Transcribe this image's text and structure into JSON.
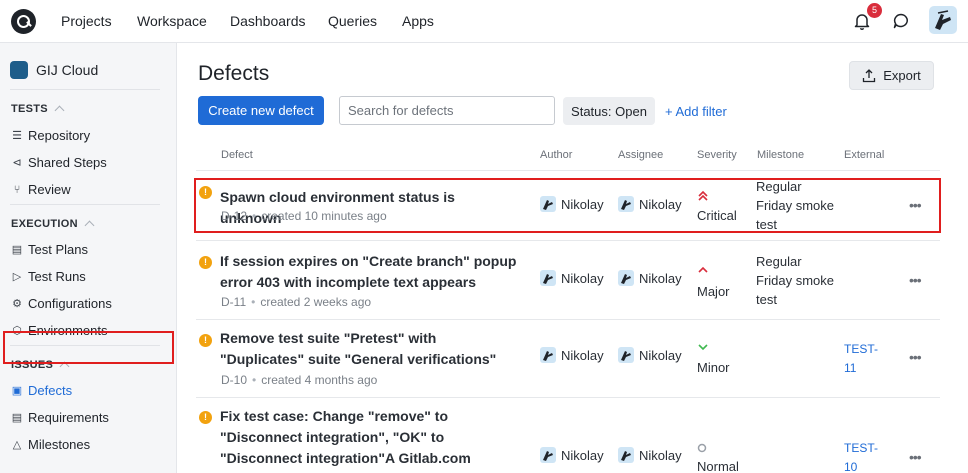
{
  "topnav": {
    "items": [
      "Projects",
      "Workspace",
      "Dashboards",
      "Queries",
      "Apps"
    ],
    "notification_count": "5"
  },
  "sidebar": {
    "project_name": "GIJ Cloud",
    "sections": [
      {
        "title": "TESTS",
        "items": [
          "Repository",
          "Shared Steps",
          "Review"
        ]
      },
      {
        "title": "EXECUTION",
        "items": [
          "Test Plans",
          "Test Runs",
          "Configurations",
          "Environments"
        ]
      },
      {
        "title": "ISSUES",
        "items": [
          "Defects",
          "Requirements",
          "Milestones"
        ]
      }
    ]
  },
  "page": {
    "title": "Defects",
    "export_label": "Export",
    "create_label": "Create new defect",
    "search_placeholder": "Search for defects",
    "status_filter": "Status: Open",
    "add_filter": "+ Add filter"
  },
  "table": {
    "headers": [
      "Defect",
      "Author",
      "Assignee",
      "Severity",
      "Milestone",
      "External"
    ],
    "rows": [
      {
        "title": "Spawn cloud environment status is unknown",
        "id": "D-12",
        "created": "created 10 minutes ago",
        "author": "Nikolay",
        "assignee": "Nikolay",
        "severity": "Critical",
        "milestone": "Regular Friday smoke test",
        "external": ""
      },
      {
        "title": "If session expires on \"Create branch\" popup error 403 with incomplete text appears",
        "id": "D-11",
        "created": "created 2 weeks ago",
        "author": "Nikolay",
        "assignee": "Nikolay",
        "severity": "Major",
        "milestone": "Regular Friday smoke test",
        "external": ""
      },
      {
        "title": "Remove test suite \"Pretest\" with \"Duplicates\" suite \"General verifications\"",
        "id": "D-10",
        "created": "created 4 months ago",
        "author": "Nikolay",
        "assignee": "Nikolay",
        "severity": "Minor",
        "milestone": "",
        "external": "TEST-11"
      },
      {
        "title": "Fix test case: Change \"remove\" to \"Disconnect integration\", \"OK\" to \"Disconnect integration\"A Gitlab.com integration can be",
        "id": "",
        "created": "",
        "author": "Nikolay",
        "assignee": "Nikolay",
        "severity": "Normal",
        "milestone": "",
        "external": "TEST-10"
      }
    ]
  },
  "colors": {
    "accent": "#1f6bd6",
    "critical": "#d92d3c",
    "minor": "#3fb950",
    "warning": "#f2a20f",
    "highlight": "#e01e1e"
  }
}
